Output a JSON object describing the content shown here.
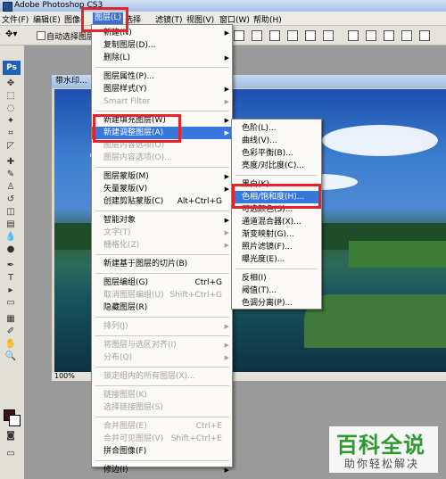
{
  "window": {
    "title": "Adobe Photoshop CS3"
  },
  "menubar": {
    "items": [
      {
        "label": "文件(F)"
      },
      {
        "label": "编辑(E)"
      },
      {
        "label": "图像("
      },
      {
        "label": "图层(L)"
      },
      {
        "label": "选择"
      },
      {
        "label": "滤镜(T)"
      },
      {
        "label": "视图(V)"
      },
      {
        "label": "窗口(W)"
      },
      {
        "label": "帮助(H)"
      }
    ]
  },
  "options_bar": {
    "auto_select_label": "自动选择图层"
  },
  "toolbox": {
    "badge": "Ps"
  },
  "document": {
    "title": "带水印...",
    "zoom": "100%"
  },
  "layer_menu": {
    "items": [
      {
        "label": "新建(N)",
        "submenu": true
      },
      {
        "label": "复制图层(D)..."
      },
      {
        "label": "删除(L)",
        "submenu": true
      },
      {
        "sep": true
      },
      {
        "label": "图层属性(P)..."
      },
      {
        "label": "图层样式(Y)",
        "submenu": true
      },
      {
        "label": "Smart Filter",
        "disabled": true,
        "submenu": true
      },
      {
        "sep": true
      },
      {
        "label": "新建填充图层(W)",
        "submenu": true
      },
      {
        "label": "新建调整图层(A)",
        "submenu": true,
        "selected": true
      },
      {
        "label": "图层内容选项(O)",
        "disabled": true
      },
      {
        "label": "图层内容选项(O)...",
        "disabled": true
      },
      {
        "sep": true
      },
      {
        "label": "图层蒙版(M)",
        "submenu": true
      },
      {
        "label": "矢量蒙版(V)",
        "submenu": true
      },
      {
        "label": "创建剪贴蒙版(C)",
        "shortcut": "Alt+Ctrl+G"
      },
      {
        "sep": true
      },
      {
        "label": "智能对象",
        "submenu": true
      },
      {
        "label": "文字(T)",
        "disabled": true,
        "submenu": true
      },
      {
        "label": "栅格化(Z)",
        "disabled": true,
        "submenu": true
      },
      {
        "sep": true
      },
      {
        "label": "新建基于图层的切片(B)"
      },
      {
        "sep": true
      },
      {
        "label": "图层编组(G)",
        "shortcut": "Ctrl+G"
      },
      {
        "label": "取消图层编组(U)",
        "shortcut": "Shift+Ctrl+G",
        "disabled": true
      },
      {
        "label": "隐藏图层(R)"
      },
      {
        "sep": true
      },
      {
        "label": "排列(J)",
        "disabled": true,
        "submenu": true
      },
      {
        "sep": true
      },
      {
        "label": "将图层与选区对齐(I)",
        "disabled": true,
        "submenu": true
      },
      {
        "label": "分布(Q)",
        "disabled": true,
        "submenu": true
      },
      {
        "sep": true
      },
      {
        "label": "锁定组内的所有图层(X)...",
        "disabled": true
      },
      {
        "sep": true
      },
      {
        "label": "链接图层(K)",
        "disabled": true
      },
      {
        "label": "选择链接图层(S)",
        "disabled": true
      },
      {
        "sep": true
      },
      {
        "label": "合并图层(E)",
        "shortcut": "Ctrl+E",
        "disabled": true
      },
      {
        "label": "合并可见图层(V)",
        "shortcut": "Shift+Ctrl+E",
        "disabled": true
      },
      {
        "label": "拼合图像(F)"
      },
      {
        "sep": true
      },
      {
        "label": "修边(I)",
        "submenu": true
      }
    ]
  },
  "adjust_submenu": {
    "items": [
      {
        "label": "色阶(L)..."
      },
      {
        "label": "曲线(V)..."
      },
      {
        "label": "色彩平衡(B)..."
      },
      {
        "label": "亮度/对比度(C)..."
      },
      {
        "sep": true
      },
      {
        "label": "黑白(K)..."
      },
      {
        "label": "色相/饱和度(H)...",
        "selected": true
      },
      {
        "label": "可选颜色(S)..."
      },
      {
        "label": "通道混合器(X)..."
      },
      {
        "label": "渐变映射(G)..."
      },
      {
        "label": "照片滤镜(F)..."
      },
      {
        "label": "曝光度(E)..."
      },
      {
        "sep": true
      },
      {
        "label": "反相(I)"
      },
      {
        "label": "阈值(T)..."
      },
      {
        "label": "色调分离(P)..."
      }
    ]
  },
  "watermark": {
    "title": "百科全说",
    "subtitle": "助你轻松解决"
  },
  "colors": {
    "accent": "#3878dc",
    "highlight": "#e8222a"
  }
}
